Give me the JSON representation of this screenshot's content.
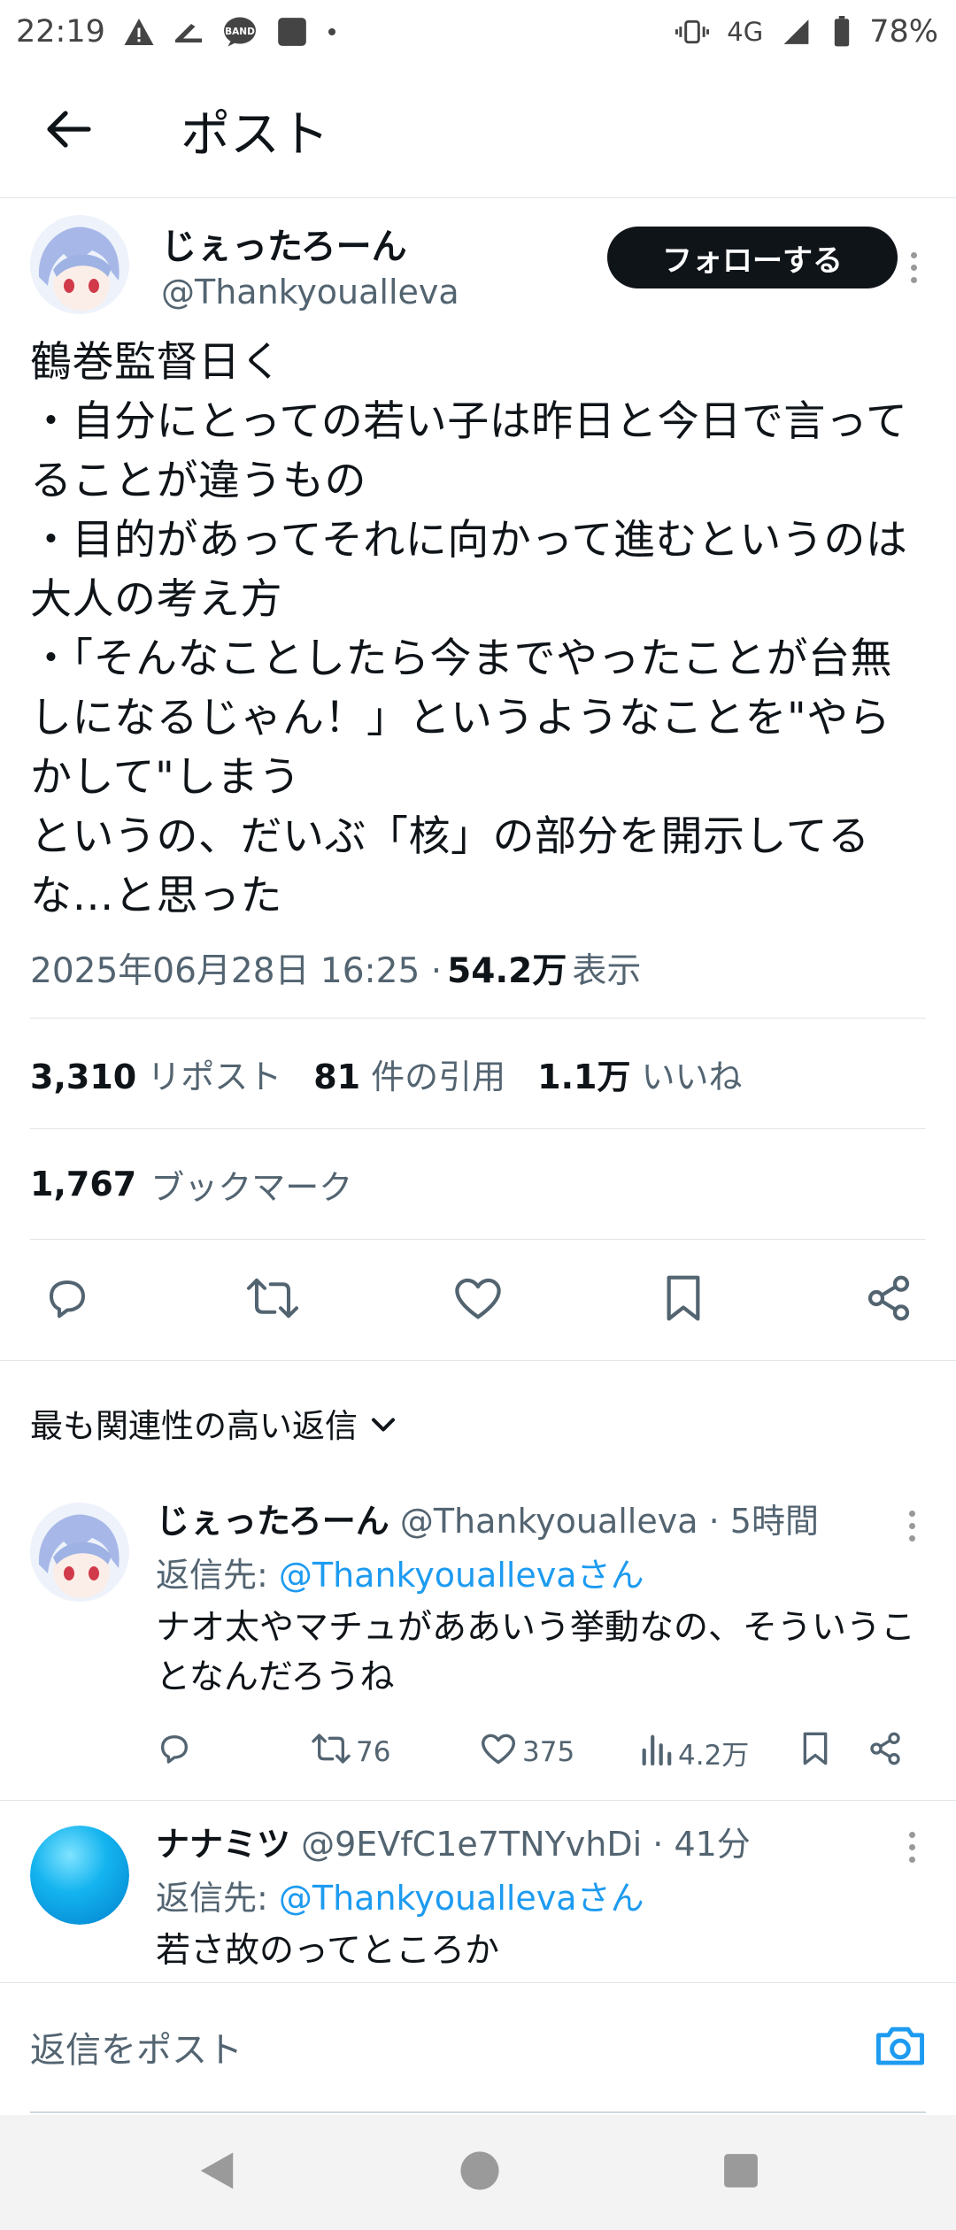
{
  "status": {
    "time": "22:19",
    "network": "4G",
    "battery": "78%"
  },
  "appbar": {
    "title": "ポスト"
  },
  "post": {
    "display_name": "じぇったろーん",
    "handle": "@Thankyoualleva",
    "follow_label": "フォローする",
    "text": "鶴巻監督日く\n・自分にとっての若い子は昨日と今日で言ってることが違うもの\n・目的があってそれに向かって進むというのは大人の考え方\n・「そんなことしたら今までやったことが台無しになるじゃん！」というようなことを\"やらかして\"しまう\nというの、だいぶ「核」の部分を開示してるな…と思った",
    "timestamp": "2025年06月28日 16:25 ·",
    "views": "54.2万",
    "views_label": "表示",
    "reposts": "3,310",
    "reposts_label": "リポスト",
    "quotes": "81",
    "quotes_label": "件の引用",
    "likes": "1.1万",
    "likes_label": "いいね",
    "bookmarks": "1,767",
    "bookmarks_label": "ブックマーク"
  },
  "sort_label": "最も関連性の高い返信",
  "replies": [
    {
      "display_name": "じぇったろーん",
      "handle": "@Thankyoualleva",
      "age": "· 5時間",
      "reply_to_prefix": "返信先: ",
      "reply_to": "@Thankyouallevaさん",
      "text": "ナオ太やマチュがああいう挙動なの、そういうことなんだろうね",
      "retweets": "76",
      "likes": "375",
      "views": "4.2万"
    },
    {
      "display_name": "ナナミツ",
      "handle": "@9EVfC1e7TNYvhDi",
      "age": "· 41分",
      "reply_to_prefix": "返信先: ",
      "reply_to": "@Thankyouallevaさん",
      "text": "若さ故のってところか"
    }
  ],
  "compose": {
    "placeholder": "返信をポスト"
  },
  "icons": [
    "back-arrow-icon",
    "reply-icon",
    "retweet-icon",
    "like-icon",
    "bookmark-icon",
    "share-icon",
    "camera-icon",
    "chevron-down-icon"
  ],
  "colors": {
    "accent": "#1d9bf0",
    "text": "#0f1419",
    "muted": "#536471",
    "follow_bg": "#0f1419"
  }
}
